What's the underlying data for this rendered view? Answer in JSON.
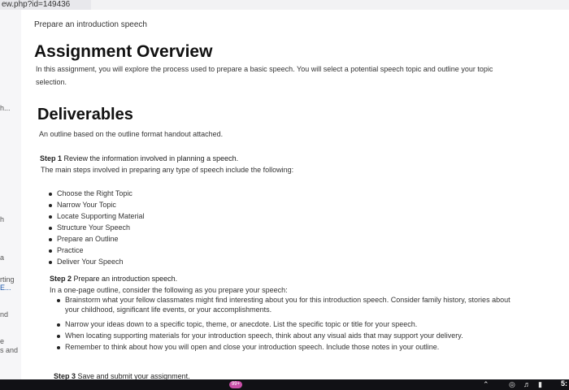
{
  "browser": {
    "url_fragment": "ew.php?id=149436"
  },
  "left_strip": {
    "items": [
      {
        "text": "h...",
        "link": false
      },
      {
        "text": "h",
        "link": false
      },
      {
        "text": "a",
        "link": false
      },
      {
        "text": "rting",
        "link": false
      },
      {
        "text": "E...",
        "link": true
      },
      {
        "text": "nd",
        "link": false
      },
      {
        "text": "e",
        "link": false
      },
      {
        "text": "s and",
        "link": false
      }
    ]
  },
  "page": {
    "breadcrumb": "Prepare an introduction speech",
    "title": "Assignment Overview",
    "intro_line1": "In this assignment, you will explore the process used to prepare a basic speech. You will select a potential speech topic and outline your topic",
    "intro_line2": "selection.",
    "deliverables_heading": "Deliverables",
    "deliverables_text": "An outline based on the outline format handout attached.",
    "step1": {
      "label": "Step 1",
      "text": "Review the information involved in planning a speech.",
      "subtext": "The main steps involved in preparing any type of speech include the following:",
      "items": [
        "Choose the Right Topic",
        "Narrow Your Topic",
        "Locate Supporting Material",
        "Structure Your Speech",
        "Prepare an Outline",
        "Practice",
        "Deliver Your Speech"
      ]
    },
    "step2": {
      "label": "Step 2",
      "text": "Prepare an introduction speech.",
      "subtext": "In a one-page outline, consider the following as you prepare your speech:",
      "items": [
        {
          "line1": "Brainstorm what your fellow classmates might find interesting about you for this introduction speech. Consider family history, stories about",
          "line2": "your childhood, significant life events, or your accomplishments."
        },
        {
          "line1": "Narrow your ideas down to a specific topic, theme, or anecdote. List the specific topic or title for your speech.",
          "line2": ""
        },
        {
          "line1": "When locating supporting materials for your introduction speech, think about any visual aids that may support your delivery.",
          "line2": ""
        },
        {
          "line1": "Remember to think about how you will open and close your introduction speech. Include those notes in your outline.",
          "line2": ""
        }
      ]
    },
    "step3": {
      "label": "Step 3",
      "text": "Save and submit your assignment."
    }
  },
  "taskbar": {
    "badge": "99+",
    "icons": [
      "chevron-up-icon",
      "wifi-icon",
      "volume-icon",
      "battery-icon"
    ],
    "time": "5:"
  }
}
